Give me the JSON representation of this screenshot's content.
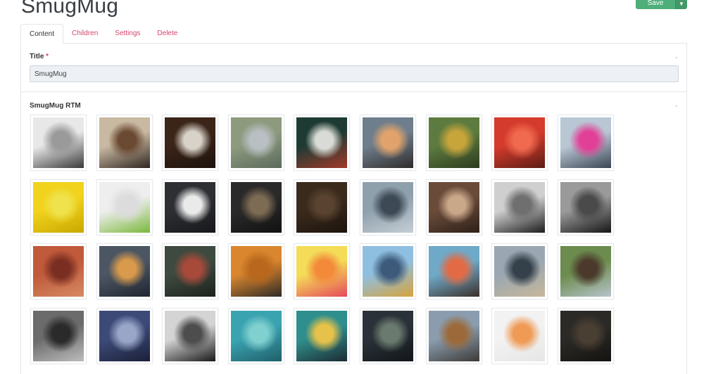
{
  "page": {
    "title": "SmugMug",
    "save_label": "Save"
  },
  "tabs": [
    {
      "label": "Content",
      "active": true
    },
    {
      "label": "Children",
      "active": false
    },
    {
      "label": "Settings",
      "active": false
    },
    {
      "label": "Delete",
      "active": false
    }
  ],
  "title_field": {
    "label": "Title",
    "required_mark": "*",
    "value": "SmugMug"
  },
  "gallery": {
    "label": "SmugMug RTM",
    "images": [
      {
        "subject": "venice-gondola-bw",
        "colors": [
          "#e8e8e8",
          "#9a9a9a",
          "#3a3a3a"
        ]
      },
      {
        "subject": "woman-on-balcony",
        "colors": [
          "#c9b9a2",
          "#6b4a33",
          "#2f2620"
        ]
      },
      {
        "subject": "notebook-sketch",
        "colors": [
          "#3b2418",
          "#d8d2c8",
          "#1c120d"
        ]
      },
      {
        "subject": "woman-lying-on-grass",
        "colors": [
          "#8d9a7e",
          "#b9bfc2",
          "#5b6a5c"
        ]
      },
      {
        "subject": "jingle-bell-card",
        "colors": [
          "#1e3b33",
          "#d9dcd6",
          "#a23a2a"
        ]
      },
      {
        "subject": "man-with-orange-car",
        "colors": [
          "#6f7e8c",
          "#e1a36b",
          "#2e2b2a"
        ]
      },
      {
        "subject": "woman-in-forest",
        "colors": [
          "#5d7b3f",
          "#c7a53b",
          "#2c3a1f"
        ]
      },
      {
        "subject": "flamingo",
        "colors": [
          "#d43b2c",
          "#f06a4f",
          "#5b1d16"
        ]
      },
      {
        "subject": "pink-phone-booth",
        "colors": [
          "#b9c7d4",
          "#e23f97",
          "#3b4553"
        ]
      },
      {
        "subject": "banana-on-yellow",
        "colors": [
          "#f1d21c",
          "#efe24a",
          "#c9a800"
        ]
      },
      {
        "subject": "hand-with-lime",
        "colors": [
          "#eeeeee",
          "#dcdcdc",
          "#7ab83c"
        ]
      },
      {
        "subject": "vinyl-record",
        "colors": [
          "#2d2f33",
          "#eaeaea",
          "#17181a"
        ]
      },
      {
        "subject": "gift-box-dark",
        "colors": [
          "#2a2a2a",
          "#7d6b53",
          "#111111"
        ]
      },
      {
        "subject": "dark-woods",
        "colors": [
          "#3a2a1c",
          "#5a4330",
          "#1d140d"
        ]
      },
      {
        "subject": "suspension-bridge",
        "colors": [
          "#8fa0ad",
          "#3d4a55",
          "#c5ced4"
        ]
      },
      {
        "subject": "museum-hall",
        "colors": [
          "#6a4b3a",
          "#c9a789",
          "#2e2019"
        ]
      },
      {
        "subject": "old-man-beard-bw",
        "colors": [
          "#cfcfcf",
          "#6f6f6f",
          "#1c1c1c"
        ]
      },
      {
        "subject": "old-man-face-bw",
        "colors": [
          "#9a9a9a",
          "#4a4a4a",
          "#161616"
        ]
      },
      {
        "subject": "rope-on-brick",
        "colors": [
          "#c05a3a",
          "#7a2e22",
          "#d68a63"
        ]
      },
      {
        "subject": "station-traveler",
        "colors": [
          "#4c5663",
          "#d99a4b",
          "#1f2530"
        ]
      },
      {
        "subject": "vintage-dashboard",
        "colors": [
          "#3e4a3f",
          "#a84a3a",
          "#1c211d"
        ]
      },
      {
        "subject": "mailbox-orange-wall",
        "colors": [
          "#d9862f",
          "#b8671d",
          "#2f2a26"
        ]
      },
      {
        "subject": "citrus-slices",
        "colors": [
          "#f4dc58",
          "#f28a3a",
          "#e6495a"
        ]
      },
      {
        "subject": "denim-backpack",
        "colors": [
          "#8fbfe0",
          "#3d5a7a",
          "#d7a33c"
        ]
      },
      {
        "subject": "fruit-bowl",
        "colors": [
          "#6fa9c8",
          "#e26b45",
          "#3c2f2a"
        ]
      },
      {
        "subject": "vintage-truck",
        "colors": [
          "#9aa7b2",
          "#34404a",
          "#c7b79a"
        ]
      },
      {
        "subject": "easter-island-moai",
        "colors": [
          "#6c8b4e",
          "#4b3a2c",
          "#b7c4cc"
        ]
      },
      {
        "subject": "turntable",
        "colors": [
          "#6b6b6b",
          "#2a2a2a",
          "#bcbcbc"
        ]
      },
      {
        "subject": "temple-gate",
        "colors": [
          "#3c4a78",
          "#9aa6c8",
          "#1b2038"
        ]
      },
      {
        "subject": "car-steering-wheel-bw",
        "colors": [
          "#d4d4d4",
          "#4d4d4d",
          "#1a1a1a"
        ]
      },
      {
        "subject": "coral-reef",
        "colors": [
          "#3aa3b0",
          "#7fd0cf",
          "#1f5f6a"
        ]
      },
      {
        "subject": "woman-on-train",
        "colors": [
          "#2f8f8c",
          "#e6c24a",
          "#1d2b33"
        ]
      },
      {
        "subject": "city-aerial-night",
        "colors": [
          "#2a3138",
          "#6b7a6e",
          "#12161a"
        ]
      },
      {
        "subject": "brown-boots",
        "colors": [
          "#8a9cae",
          "#9c6a3a",
          "#3d3a37"
        ]
      },
      {
        "subject": "hand-with-orange",
        "colors": [
          "#f2f2f2",
          "#ef9a55",
          "#e6e6e6"
        ]
      },
      {
        "subject": "dark-forest-path",
        "colors": [
          "#2c2a26",
          "#4a3f33",
          "#141311"
        ]
      }
    ]
  }
}
